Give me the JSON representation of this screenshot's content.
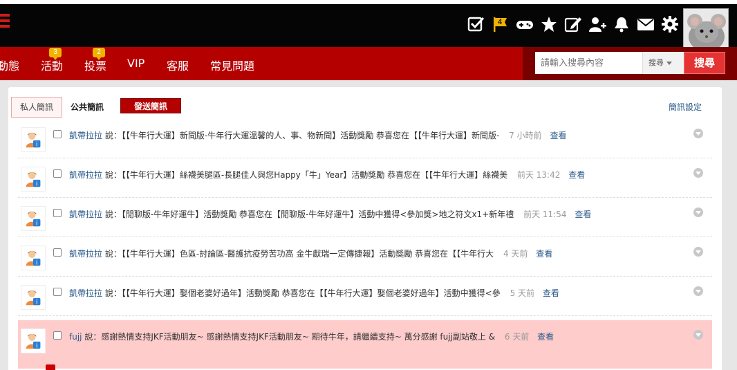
{
  "topbar": {
    "icons": [
      "checklist-icon",
      "flag-icon",
      "gamepad-icon",
      "star-icon",
      "edit-icon",
      "add-user-icon",
      "bell-icon",
      "mail-icon",
      "gear-icon"
    ],
    "flag_count": "4"
  },
  "nav": {
    "items": [
      {
        "label": "動態",
        "badge": ""
      },
      {
        "label": "活動",
        "badge": "3"
      },
      {
        "label": "投票",
        "badge": "2"
      },
      {
        "label": "VIP",
        "badge": ""
      },
      {
        "label": "客服",
        "badge": ""
      },
      {
        "label": "常見問題",
        "badge": ""
      }
    ],
    "search_placeholder": "請輸入搜尋內容",
    "search_select": "搜尋",
    "search_button": "搜尋"
  },
  "panel": {
    "tab_private": "私人簡訊",
    "tab_public": "公共簡訊",
    "send_button": "發送簡訊",
    "settings_link": "簡訊設定"
  },
  "messages": [
    {
      "sender": "凱帶拉拉",
      "says": "說：",
      "text": "【【牛年行大運】新聞版-牛年行大運溫馨的人、事、物新聞】活動獎勵 恭喜您在【【牛年行大運】新聞版-",
      "time": "7 小時前",
      "view": "查看"
    },
    {
      "sender": "凱帶拉拉",
      "says": "說：",
      "text": "【【牛年行大運】絲襪美腿區-長腿佳人與您Happy「牛」Year】活動獎勵 恭喜您在【【牛年行大運】絲襪美",
      "time": "前天 13:42",
      "view": "查看"
    },
    {
      "sender": "凱帶拉拉",
      "says": "說：",
      "text": "【閒聊版-牛年好運牛】活動獎勵 恭喜您在【閒聊版-牛年好運牛】活動中獲得<參加獎>地之符文x1+新年禮",
      "time": "前天 11:54",
      "view": "查看"
    },
    {
      "sender": "凱帶拉拉",
      "says": "說：",
      "text": "【【牛年行大運】色區-討論區-醫護抗疫勞苦功高 金牛獻瑞一定傳捷報】活動獎勵 恭喜您在【【牛年行大",
      "time": "4 天前",
      "view": "查看"
    },
    {
      "sender": "凱帶拉拉",
      "says": "說：",
      "text": "【【牛年行大運】娶個老婆好過年】活動獎勵 恭喜您在【【牛年行大運】娶個老婆好過年】活動中獲得<參",
      "time": "5 天前",
      "view": "查看"
    },
    {
      "sender": "fujj",
      "says": "說：",
      "text": "感謝熱情支持JKF活動朋友~ 感謝熱情支持JKF活動朋友~ 期待牛年，請繼續支持~ 萬分感謝 fujj副站敬上 &",
      "time": "6 天前",
      "view": "查看"
    }
  ]
}
